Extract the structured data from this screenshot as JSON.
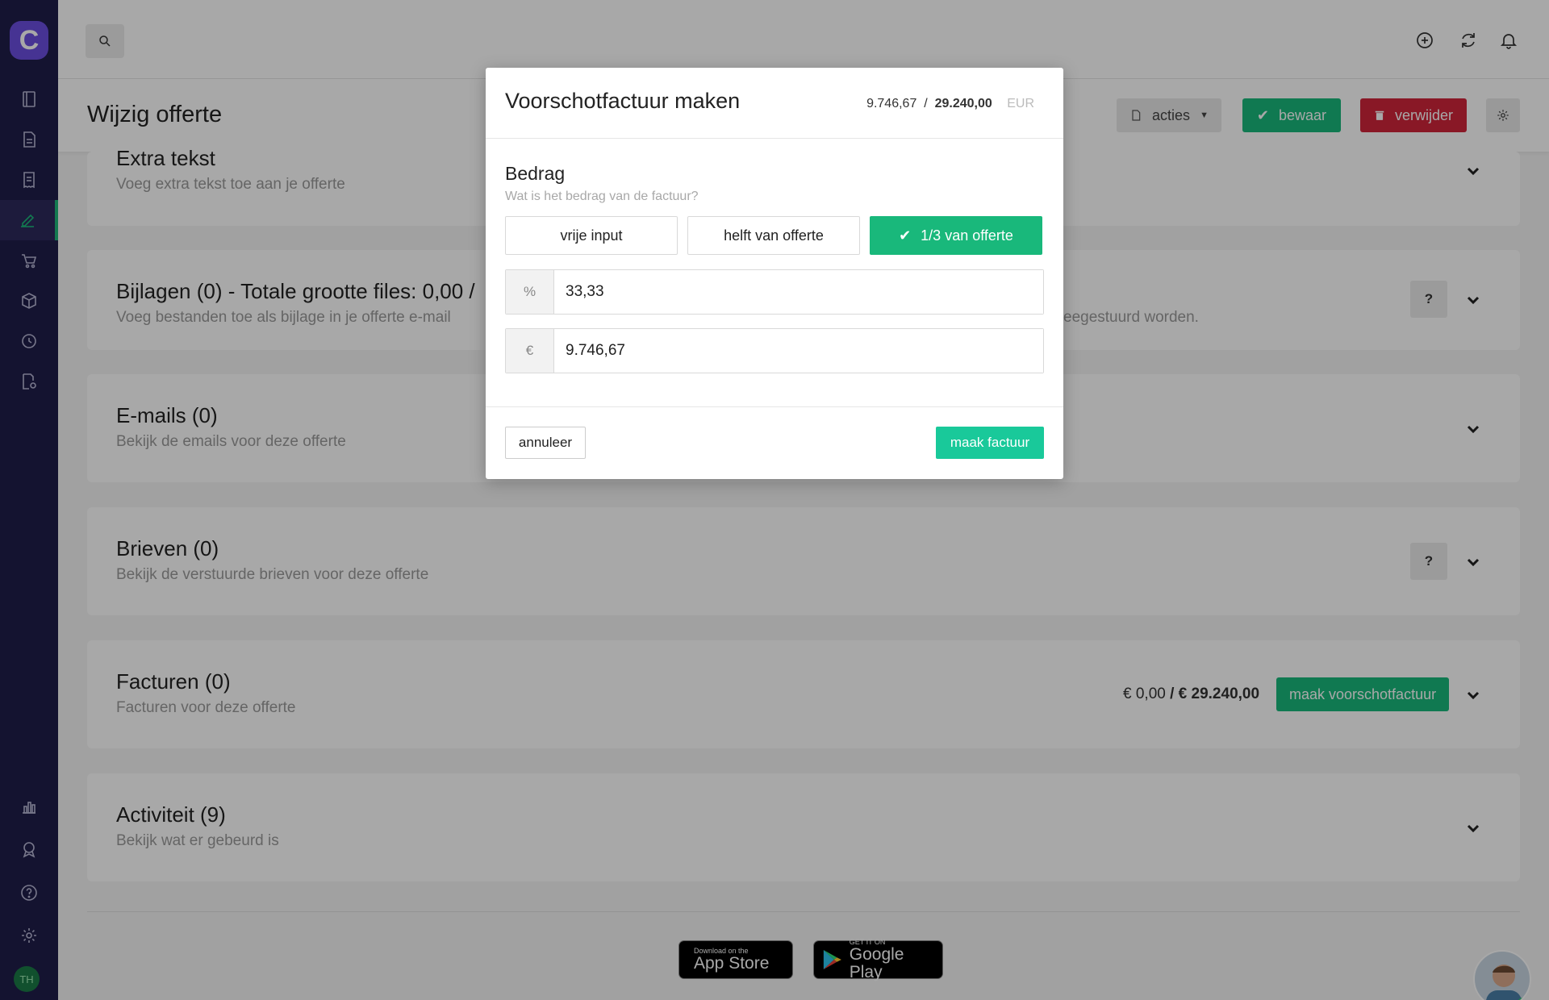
{
  "page": {
    "title": "Wijzig offerte",
    "actions": {
      "acties": "acties",
      "bewaar": "bewaar",
      "verwijder": "verwijder"
    }
  },
  "sidebar": {
    "logo": "C",
    "items": [
      {
        "name": "book-icon"
      },
      {
        "name": "document-icon"
      },
      {
        "name": "receipt-icon"
      },
      {
        "name": "quote-edit-icon",
        "active": true
      },
      {
        "name": "cart-icon"
      },
      {
        "name": "box-icon"
      },
      {
        "name": "clock-icon"
      },
      {
        "name": "report-settings-icon"
      }
    ],
    "bottom_items": [
      {
        "name": "bar-chart-icon"
      },
      {
        "name": "badge-icon"
      },
      {
        "name": "help-icon"
      },
      {
        "name": "gear-icon"
      }
    ],
    "user_initials": "TH"
  },
  "cards": {
    "extra": {
      "title": "Extra tekst",
      "subtitle": "Voeg extra tekst toe aan je offerte"
    },
    "bijlagen": {
      "title": "Bijlagen  (0) - Totale grootte files: 0,00 /",
      "subtitle": "Voeg bestanden toe als bijlage in je offerte e-mail",
      "subtitle_tail": "eegestuurd worden.",
      "help": "?"
    },
    "emails": {
      "title": "E-mails  (0)",
      "subtitle": "Bekijk de emails voor deze offerte"
    },
    "brieven": {
      "title": "Brieven  (0)",
      "subtitle": "Bekijk de verstuurde brieven voor deze offerte",
      "help": "?"
    },
    "facturen": {
      "title": "Facturen  (0)",
      "subtitle": "Facturen voor deze offerte",
      "total_paid": "€ 0,00",
      "total_sep": " / ",
      "total_offer": "€ 29.240,00",
      "button": "maak voorschotfactuur"
    },
    "activiteit": {
      "title": "Activiteit  (9)",
      "subtitle": "Bekijk wat er gebeurd is"
    }
  },
  "stores": {
    "apple": {
      "small": "Download on the",
      "big": "App Store"
    },
    "google": {
      "small": "GET IT ON",
      "big": "Google Play"
    }
  },
  "modal": {
    "title": "Voorschotfactuur maken",
    "amount": "9.746,67",
    "separator": "/",
    "total": "29.240,00",
    "currency": "EUR",
    "section_title": "Bedrag",
    "section_sub": "Wat is het bedrag van de factuur?",
    "options": [
      "vrije input",
      "helft van offerte",
      "1/3 van offerte"
    ],
    "selected_option": 2,
    "percent_addon": "%",
    "percent_value": "33,33",
    "euro_addon": "€",
    "euro_value": "9.746,67",
    "cancel": "annuleer",
    "submit": "maak factuur"
  },
  "colors": {
    "sidebar": "#1f1d4a",
    "green": "#19b87b",
    "red": "#d1253a",
    "accent": "#6b4ee0"
  }
}
